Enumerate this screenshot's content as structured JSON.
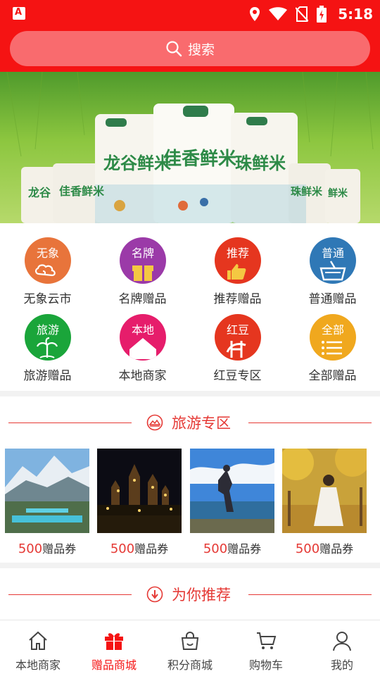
{
  "status_bar": {
    "time": "5:18",
    "left_badge": "A",
    "icons": [
      "location-icon",
      "wifi-icon",
      "no-sim-icon",
      "battery-icon"
    ]
  },
  "search": {
    "label": "搜索",
    "icon": "search-icon"
  },
  "banner": {
    "product_texts": [
      "龙谷鲜米",
      "佳香鲜米",
      "珠鲜米",
      "龙谷",
      "佳香鲜米",
      "珠鲜米",
      "鲜米"
    ]
  },
  "categories": [
    {
      "label": "无象云市",
      "icon_text": "无象",
      "color": "#e8743b",
      "icon": "cloud-icon"
    },
    {
      "label": "名牌赠品",
      "icon_text": "名牌",
      "color": "#9b3aa8",
      "icon": "gift-icon"
    },
    {
      "label": "推荐赠品",
      "icon_text": "推荐",
      "color": "#e5361f",
      "icon": "thumbs-up-icon"
    },
    {
      "label": "普通赠品",
      "icon_text": "普通",
      "color": "#2f78b6",
      "icon": "basket-icon"
    },
    {
      "label": "旅游赠品",
      "icon_text": "旅游",
      "color": "#1aa53a",
      "icon": "palm-tree-icon"
    },
    {
      "label": "本地商家",
      "icon_text": "本地",
      "color": "#e61d6b",
      "icon": "house-icon"
    },
    {
      "label": "红豆专区",
      "icon_text": "红豆",
      "color": "#e5361f",
      "icon": "logo-icon"
    },
    {
      "label": "全部赠品",
      "icon_text": "全部",
      "color": "#f0a81e",
      "icon": "list-icon"
    }
  ],
  "travel_section": {
    "title": "旅游专区",
    "icon": "travel-icon",
    "items": [
      {
        "amount": "500",
        "unit": "赠品券",
        "image": "mountain-lake-photo"
      },
      {
        "amount": "500",
        "unit": "赠品券",
        "image": "night-castle-photo"
      },
      {
        "amount": "500",
        "unit": "赠品券",
        "image": "lakeside-person-photo"
      },
      {
        "amount": "500",
        "unit": "赠品券",
        "image": "autumn-woman-photo"
      }
    ]
  },
  "recommend_section": {
    "title": "为你推荐",
    "icon": "down-arrow-icon"
  },
  "tabbar": {
    "active_color": "#f51313",
    "items": [
      {
        "label": "本地商家",
        "icon": "home-icon",
        "active": false
      },
      {
        "label": "赠品商城",
        "icon": "gift-box-icon",
        "active": true
      },
      {
        "label": "积分商城",
        "icon": "bag-icon",
        "active": false
      },
      {
        "label": "购物车",
        "icon": "cart-icon",
        "active": false
      },
      {
        "label": "我的",
        "icon": "user-icon",
        "active": false
      }
    ]
  },
  "colors": {
    "brand": "#f51313",
    "search_bg": "#f96b6e",
    "accent_text": "#e53935"
  }
}
